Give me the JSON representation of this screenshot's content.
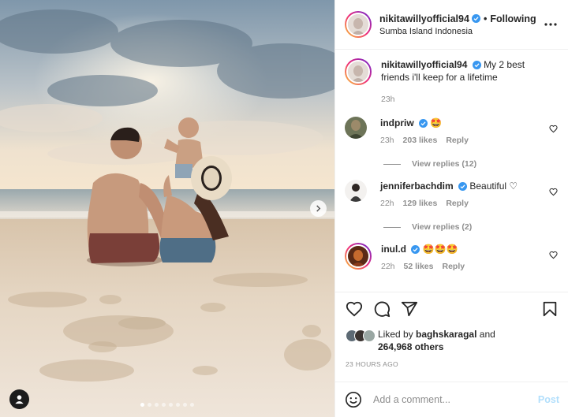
{
  "post": {
    "username": "nikitawillyofficial94",
    "follow_state": "Following",
    "separator": "•",
    "location": "Sumba Island Indonesia",
    "more_icon": "more-horizontal-icon",
    "carousel_count": 8,
    "carousel_active": 1
  },
  "caption": {
    "username": "nikitawillyofficial94",
    "text": "My 2 best friends i'll keep for a lifetime",
    "time": "23h"
  },
  "comments": [
    {
      "username": "indpriw",
      "text": "🤩",
      "time": "23h",
      "likes": "203 likes",
      "reply_label": "Reply",
      "view_replies": "View replies (12)"
    },
    {
      "username": "jenniferbachdim",
      "text": "Beautiful ♡",
      "time": "22h",
      "likes": "129 likes",
      "reply_label": "Reply",
      "view_replies": "View replies (2)"
    },
    {
      "username": "inul.d",
      "text": "🤩🤩🤩",
      "time": "22h",
      "likes": "52 likes",
      "reply_label": "Reply"
    }
  ],
  "likes": {
    "liked_by_prefix": "Liked by",
    "liked_by_user": "baghskaragal",
    "and": "and",
    "count": "264,968 others"
  },
  "timestamp": "23 HOURS AGO",
  "add_comment": {
    "placeholder": "Add a comment...",
    "post_label": "Post"
  },
  "colors": {
    "verified": "#3897f0",
    "post_disabled": "#b2dffc",
    "muted": "#8e8e8e"
  }
}
